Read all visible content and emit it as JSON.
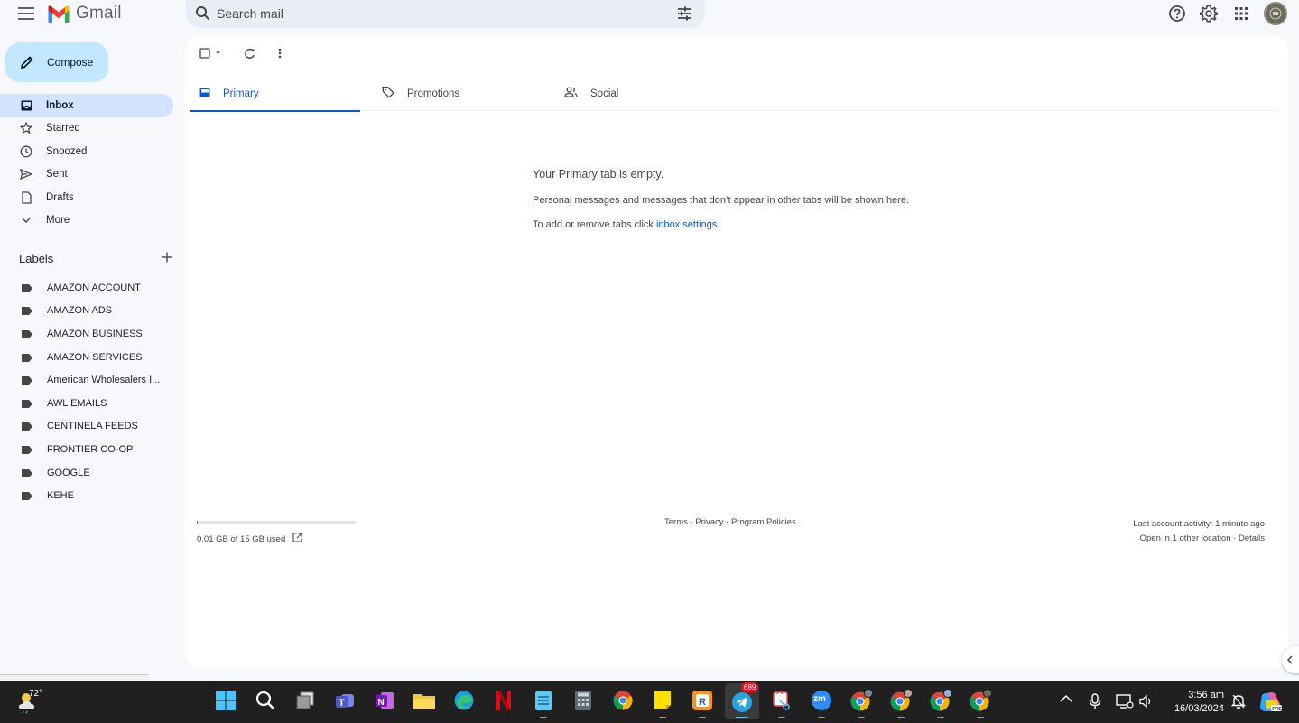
{
  "header": {
    "app_name": "Gmail",
    "search_placeholder": "Search mail"
  },
  "sidebar": {
    "compose_label": "Compose",
    "items": [
      {
        "label": "Inbox",
        "icon": "inbox-icon",
        "active": true
      },
      {
        "label": "Starred",
        "icon": "star-icon"
      },
      {
        "label": "Snoozed",
        "icon": "clock-icon"
      },
      {
        "label": "Sent",
        "icon": "send-icon"
      },
      {
        "label": "Drafts",
        "icon": "draft-icon"
      },
      {
        "label": "More",
        "icon": "chevron-down-icon"
      }
    ],
    "labels_heading": "Labels",
    "labels": [
      "AMAZON ACCOUNT",
      "AMAZON ADS",
      "AMAZON BUSINESS",
      "AMAZON SERVICES",
      "American Wholesalers I...",
      "AWL EMAILS",
      "CENTINELA FEEDS",
      "FRONTIER CO-OP",
      "GOOGLE",
      "KEHE"
    ]
  },
  "tabs": [
    {
      "label": "Primary",
      "icon": "inbox-icon",
      "active": true
    },
    {
      "label": "Promotions",
      "icon": "tag-icon"
    },
    {
      "label": "Social",
      "icon": "people-icon"
    }
  ],
  "empty_state": {
    "title": "Your Primary tab is empty.",
    "subtitle": "Personal messages and messages that don’t appear in other tabs will be shown here.",
    "settings_prefix": "To add or remove tabs click ",
    "settings_link": "inbox settings",
    "settings_suffix": "."
  },
  "footer": {
    "storage_text": "0.01 GB of 15 GB used",
    "storage_fraction": 0.001,
    "terms": "Terms",
    "privacy": "Privacy",
    "program_policies": "Program Policies",
    "separator": " · ",
    "last_activity": "Last account activity: 1 minute ago",
    "open_in": "Open in 1 other location",
    "details": "Details"
  },
  "taskbar": {
    "temperature": "72°",
    "telegram_badge": "689",
    "time": "3:56 am",
    "date": "16/03/2024",
    "zoom_label": "zm"
  },
  "colors": {
    "accent": "#0b57d0",
    "compose_bg": "#c2e7ff",
    "active_nav_bg": "#d3e3fd",
    "page_bg": "#f6f8fc"
  }
}
